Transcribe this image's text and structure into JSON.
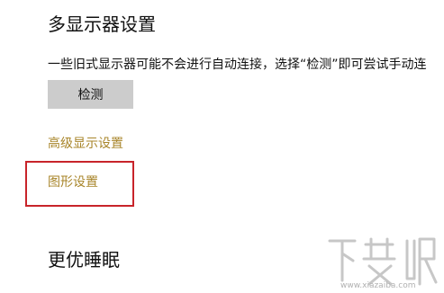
{
  "multi_display": {
    "title": "多显示器设置",
    "description": "一些旧式显示器可能不会进行自动连接，选择“检测”即可尝试手动连",
    "detect_button_label": "检测"
  },
  "links": {
    "advanced_display": "高级显示设置",
    "graphics_settings": "图形设置"
  },
  "next_section": {
    "title": "更优睡眠"
  },
  "watermark": {
    "text": "下载吧",
    "url_text": "www.xiazaiba.com"
  },
  "colors": {
    "link": "#a8852a",
    "highlight_border": "#c8242a",
    "button_bg": "#cccccc"
  }
}
